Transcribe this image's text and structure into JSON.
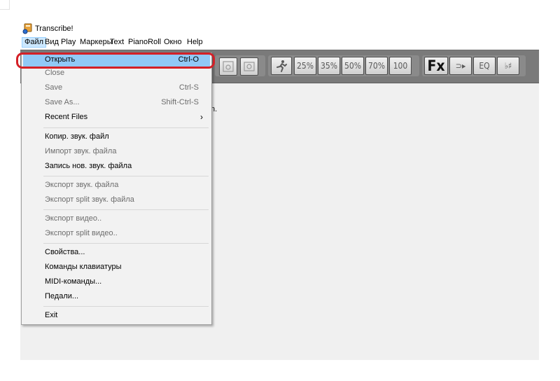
{
  "window": {
    "title": "Transcribe!"
  },
  "menubar": {
    "items": [
      "Файл",
      "Вид",
      "Play",
      "Маркеры",
      "Text",
      "PianoRoll",
      "Окно",
      "Help"
    ]
  },
  "toolbar": {
    "speed_buttons": [
      "25%",
      "35%",
      "50%",
      "70%",
      "100"
    ],
    "fx_label": "Fx",
    "eq_label": "EQ",
    "loop_label": "⊃▸",
    "pitch_label": "♭♯"
  },
  "hint_fragment": "n.",
  "file_menu": {
    "items": [
      {
        "label": "Открыть",
        "shortcut": "Ctrl-O",
        "state": "highlight"
      },
      {
        "label": "Close",
        "shortcut": "",
        "state": "disabled"
      },
      {
        "label": "Save",
        "shortcut": "Ctrl-S",
        "state": "disabled"
      },
      {
        "label": "Save As...",
        "shortcut": "Shift-Ctrl-S",
        "state": "disabled"
      },
      {
        "label": "Recent Files",
        "shortcut": "",
        "state": "enabled",
        "submenu": true
      },
      {
        "label": "Копир. звук. файл",
        "shortcut": "",
        "state": "enabled"
      },
      {
        "label": "Импорт звук. файла",
        "shortcut": "",
        "state": "disabled"
      },
      {
        "label": "Запись нов. звук. файла",
        "shortcut": "",
        "state": "enabled"
      },
      {
        "label": "Экспорт звук. файла",
        "shortcut": "",
        "state": "disabled"
      },
      {
        "label": "Экспорт split звук. файла",
        "shortcut": "",
        "state": "disabled"
      },
      {
        "label": "Экспорт видео..",
        "shortcut": "",
        "state": "disabled"
      },
      {
        "label": "Экспорт split видео..",
        "shortcut": "",
        "state": "disabled"
      },
      {
        "label": "Свойства...",
        "shortcut": "",
        "state": "enabled"
      },
      {
        "label": "Команды клавиатуры",
        "shortcut": "",
        "state": "enabled"
      },
      {
        "label": "MIDI-команды...",
        "shortcut": "",
        "state": "enabled"
      },
      {
        "label": "Педали...",
        "shortcut": "",
        "state": "enabled"
      },
      {
        "label": "Exit",
        "shortcut": "",
        "state": "enabled"
      }
    ],
    "submenu_arrow": "›"
  },
  "colors": {
    "highlight": "#91c9f7",
    "annotation_ring": "#d42027",
    "toolbar_bg": "#7a7a7a"
  }
}
